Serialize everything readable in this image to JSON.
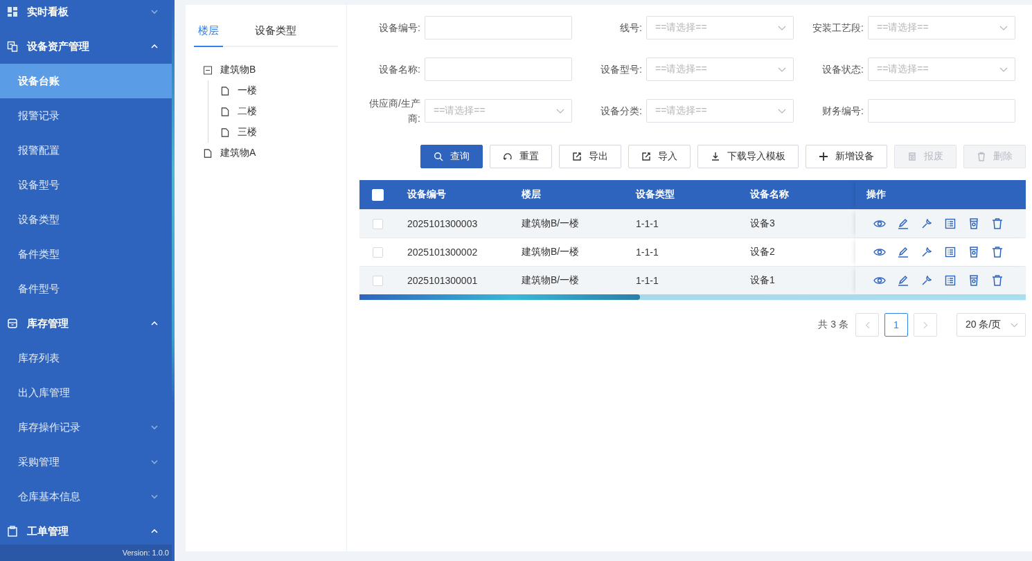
{
  "sidebar": {
    "items": [
      {
        "label": "实时看板",
        "kind": "group",
        "expanded": false,
        "selected": false
      },
      {
        "label": "设备资产管理",
        "kind": "group",
        "expanded": true,
        "selected": false,
        "children": [
          {
            "label": "设备台账",
            "kind": "item",
            "selected": true
          },
          {
            "label": "报警记录",
            "kind": "item",
            "selected": false
          },
          {
            "label": "报警配置",
            "kind": "item",
            "selected": false
          },
          {
            "label": "设备型号",
            "kind": "item",
            "selected": false
          },
          {
            "label": "设备类型",
            "kind": "item",
            "selected": false
          },
          {
            "label": "备件类型",
            "kind": "item",
            "selected": false
          },
          {
            "label": "备件型号",
            "kind": "item",
            "selected": false
          }
        ]
      },
      {
        "label": "库存管理",
        "kind": "group",
        "expanded": true,
        "selected": false,
        "children": [
          {
            "label": "库存列表",
            "kind": "item",
            "selected": false
          },
          {
            "label": "出入库管理",
            "kind": "item",
            "selected": false
          },
          {
            "label": "库存操作记录",
            "kind": "item",
            "expanded": false,
            "selected": false
          },
          {
            "label": "采购管理",
            "kind": "item",
            "expanded": false,
            "selected": false
          },
          {
            "label": "仓库基本信息",
            "kind": "item",
            "expanded": false,
            "selected": false
          }
        ]
      },
      {
        "label": "工单管理",
        "kind": "group",
        "expanded": true,
        "selected": false
      }
    ],
    "version": "Version: 1.0.0"
  },
  "tree_panel": {
    "tabs": [
      {
        "label": "楼层",
        "selected": true
      },
      {
        "label": "设备类型",
        "selected": false
      }
    ],
    "tree": [
      {
        "label": "建筑物B",
        "expanded": true,
        "children": [
          {
            "label": "一楼"
          },
          {
            "label": "二楼"
          },
          {
            "label": "三楼"
          }
        ]
      },
      {
        "label": "建筑物A"
      }
    ]
  },
  "filters": [
    {
      "label": "设备编号",
      "kind": "input"
    },
    {
      "label": "线号",
      "kind": "select",
      "placeholder": "==请选择=="
    },
    {
      "label": "安装工艺段",
      "kind": "select",
      "placeholder": "==请选择=="
    },
    {
      "label": "设备名称",
      "kind": "input"
    },
    {
      "label": "设备型号",
      "kind": "select",
      "placeholder": "==请选择=="
    },
    {
      "label": "设备状态",
      "kind": "select",
      "placeholder": "==请选择=="
    },
    {
      "label": "供应商/生产商",
      "kind": "select",
      "placeholder": "==请选择=="
    },
    {
      "label": "设备分类",
      "kind": "select",
      "placeholder": "==请选择=="
    },
    {
      "label": "财务编号",
      "kind": "input"
    }
  ],
  "label_suffix": ":",
  "buttons": [
    {
      "label": "查询",
      "primary": true,
      "disabled": false
    },
    {
      "label": "重置",
      "primary": false,
      "disabled": false
    },
    {
      "label": "导出",
      "primary": false,
      "disabled": false
    },
    {
      "label": "导入",
      "primary": false,
      "disabled": false
    },
    {
      "label": "下载导入模板",
      "primary": false,
      "disabled": false
    },
    {
      "label": "新增设备",
      "primary": false,
      "disabled": false
    },
    {
      "label": "报废",
      "primary": false,
      "disabled": true
    },
    {
      "label": "删除",
      "primary": false,
      "disabled": true
    }
  ],
  "table": {
    "header_checked": false,
    "columns": [
      "设备编号",
      "楼层",
      "设备类型",
      "设备名称",
      "操作"
    ],
    "rows": [
      {
        "checked": false,
        "cells": [
          "2025101300003",
          "建筑物B/一楼",
          "1-1-1",
          "设备3"
        ]
      },
      {
        "checked": false,
        "cells": [
          "2025101300002",
          "建筑物B/一楼",
          "1-1-1",
          "设备2"
        ]
      },
      {
        "checked": false,
        "cells": [
          "2025101300001",
          "建筑物B/一楼",
          "1-1-1",
          "设备1"
        ]
      }
    ]
  },
  "pagination": {
    "total": "共 3 条",
    "pages": [
      {
        "label": "1",
        "selected": true
      }
    ],
    "page_size": "20 条/页"
  }
}
